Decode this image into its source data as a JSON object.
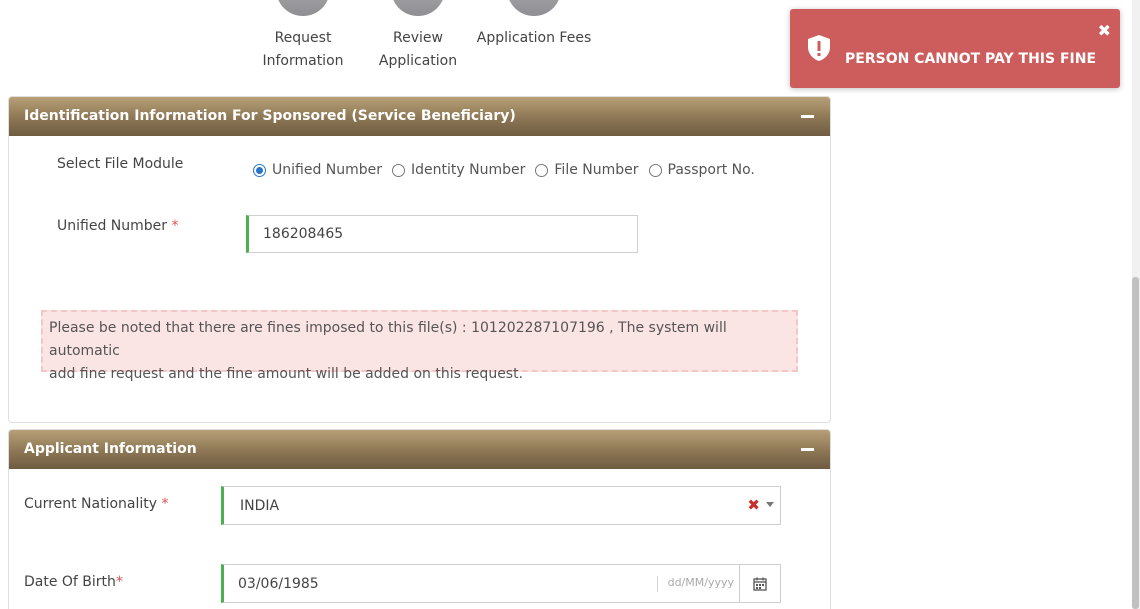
{
  "stepper": {
    "steps": [
      {
        "label_line1": "Request",
        "label_line2": "Information"
      },
      {
        "label_line1": "Review",
        "label_line2": "Application"
      },
      {
        "label_line1": "Application Fees",
        "label_line2": ""
      }
    ]
  },
  "toast": {
    "message": "PERSON CANNOT PAY THIS FINE",
    "close_glyph": "✖",
    "icon": "shield-exclamation-icon",
    "color": "#cd5c5c"
  },
  "sponsored_panel": {
    "title": "Identification Information For Sponsored (Service Beneficiary)",
    "file_module_label": "Select File Module",
    "options": [
      "Unified Number",
      "Identity Number",
      "File Number",
      "Passport No."
    ],
    "selected_option": "Unified Number",
    "unified_number_label": "Unified Number",
    "required_mark": "*",
    "unified_number_value": "186208465",
    "notice_line1": "Please be noted that there are fines imposed to this file(s) : 101202287107196 , The system will automatic",
    "notice_line2": "add fine request and the fine amount will be added on this request."
  },
  "applicant_panel": {
    "title": "Applicant Information",
    "nationality_label": "Current Nationality",
    "nationality_value": "INDIA",
    "dob_label": "Date Of Birth",
    "dob_value": "03/06/1985",
    "dob_placeholder": "dd/MM/yyyy",
    "required_mark": "*"
  },
  "colors": {
    "header_gradient_top": "#b7a077",
    "header_gradient_bottom": "#6f5c42",
    "valid_border": "#4caf50",
    "notice_bg": "#fbe4e4",
    "required": "#d9534f"
  }
}
